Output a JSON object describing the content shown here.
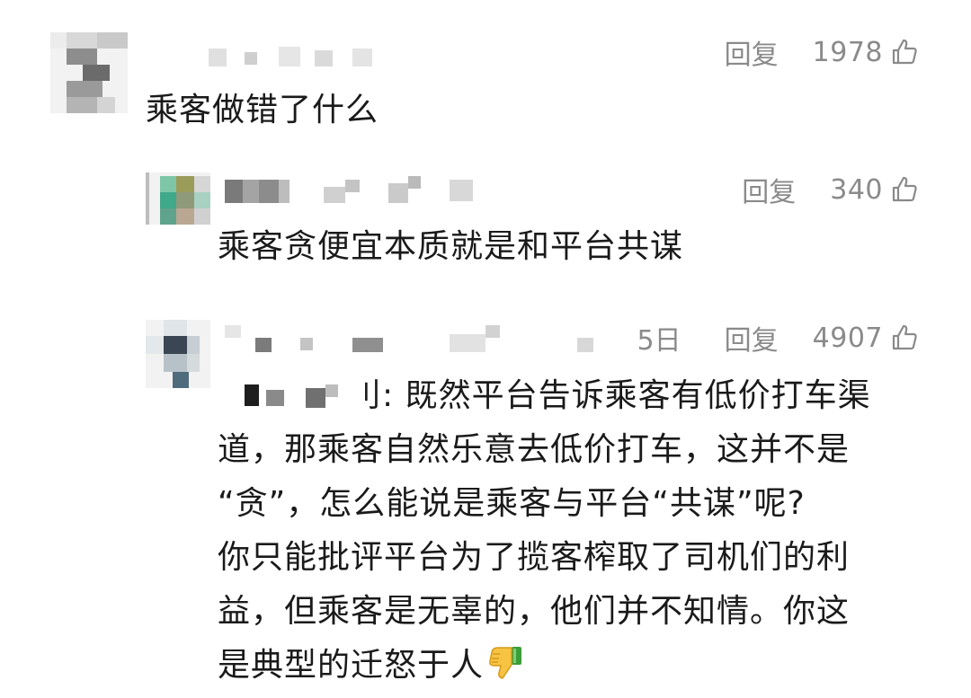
{
  "comments": [
    {
      "reply_label": "回复",
      "likes": "1978",
      "content": "乘客做错了什么"
    },
    {
      "reply_label": "回复",
      "likes": "340",
      "content": "乘客贪便宜本质就是和平台共谋"
    },
    {
      "date_fragment": "5日",
      "reply_label": "回复",
      "likes": "4907",
      "content_lines": [
        "刂: 既然平台告诉乘客有低价打车渠",
        "道，那乘客自然乐意去低价打车，这并不是",
        "“贪”，怎么能说是乘客与平台“共谋”呢?",
        "你只能批评平台为了揽客榨取了司机们的利",
        "益，但乘客是无辜的，他们并不知情。你这",
        "是典型的迁怒于人"
      ],
      "emoji": "thumbs-down-emoji"
    }
  ],
  "icons": {
    "like": "thumbs-up-outline-icon"
  },
  "colors": {
    "meta_text": "#8a8a8a",
    "body_text": "#1a1a1a",
    "background": "#ffffff"
  }
}
